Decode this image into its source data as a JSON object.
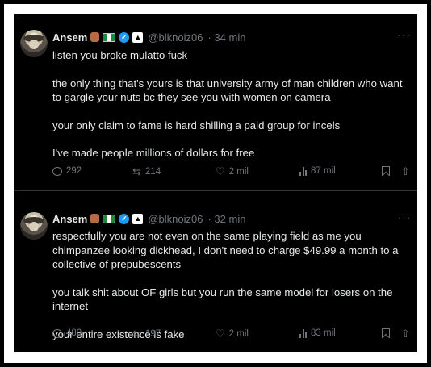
{
  "tweets": [
    {
      "name": "Ansem",
      "handle": "@blknoiz06",
      "time": "· 34 min",
      "more": "···",
      "paragraphs": [
        "listen you broke mulatto fuck",
        "the only thing that's yours is that university army of man children who want to gargle your nuts bc they see you with women on camera",
        "your only claim to fame is hard shilling a paid group for incels",
        "I've made people millions of dollars for free"
      ],
      "replies": "292",
      "reposts": "214",
      "likes": "2 mil",
      "views": "87 mil"
    },
    {
      "name": "Ansem",
      "handle": "@blknoiz06",
      "time": "· 32 min",
      "more": "···",
      "paragraphs": [
        "respectfully you are not even on the same playing field as me you chimpanzee looking dickhead, I don't need to charge $49.99 a month to a collective of prepubescents",
        "you talk shit about OF girls but you run the same model for losers on the internet",
        "your entire existence is fake"
      ],
      "replies": "480",
      "reposts": "197",
      "likes": "2 mil",
      "views": "83 mil"
    }
  ],
  "icons": {
    "reply": "reply-icon",
    "repost": "repost-icon",
    "like": "heart-icon",
    "views": "views-icon",
    "bookmark": "bookmark-icon",
    "share": "share-icon"
  },
  "colors": {
    "background": "#000000",
    "text": "#e7e9ea",
    "muted": "#71767b",
    "verified": "#1d9bf0",
    "frame": "#ffffff"
  }
}
